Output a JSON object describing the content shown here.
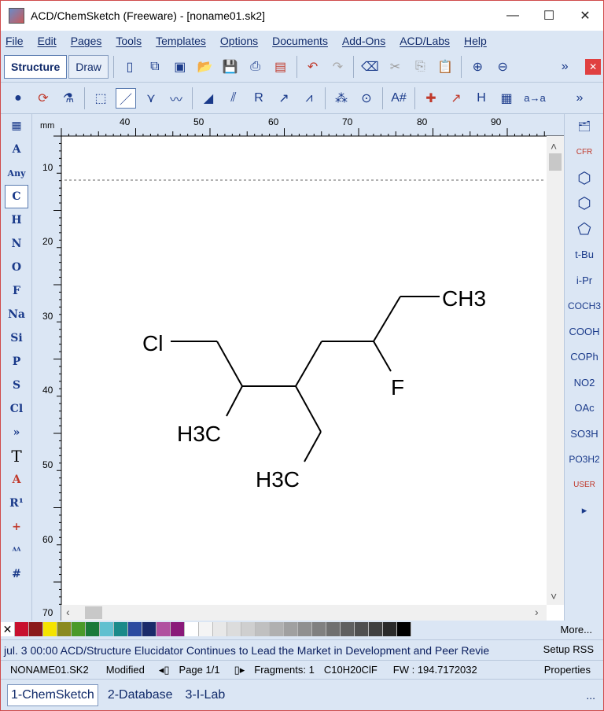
{
  "window": {
    "title": "ACD/ChemSketch (Freeware) - [noname01.sk2]",
    "controls": {
      "minimize": "—",
      "maximize": "☐",
      "close": "✕"
    }
  },
  "menu": [
    "File",
    "Edit",
    "Pages",
    "Tools",
    "Templates",
    "Options",
    "Documents",
    "Add-Ons",
    "ACD/Labs",
    "Help"
  ],
  "modes": {
    "structure": "Structure",
    "draw": "Draw"
  },
  "left_toolbar": [
    "A",
    "Any",
    "C",
    "H",
    "N",
    "O",
    "F",
    "Na",
    "Si",
    "P",
    "S",
    "Cl",
    "»",
    "T",
    "A",
    "R¹",
    "+",
    "ᴬᴬ",
    "#"
  ],
  "right_toolbar": [
    "CFR",
    "⬡",
    "⬡",
    "⬠",
    "t-Bu",
    "i-Pr",
    "COCH3",
    "COOH",
    "COPh",
    "NO2",
    "OAc",
    "SO3H",
    "PO3H2",
    "USER",
    "▸"
  ],
  "ruler": {
    "unit": "mm",
    "top_labels": [
      "40",
      "50",
      "60",
      "70",
      "80",
      "90"
    ],
    "left_labels": [
      "10",
      "20",
      "30",
      "40",
      "50",
      "60",
      "70"
    ]
  },
  "molecule": {
    "labels": {
      "cl": "Cl",
      "ch3": "CH3",
      "f": "F",
      "h3c_1": "H3C",
      "h3c_2": "H3C"
    }
  },
  "palette": {
    "more": "More..."
  },
  "news": {
    "text": "jul. 3 00:00 ACD/Structure Elucidator Continues to Lead the Market in Development and Peer Revie",
    "setup_rss": "Setup RSS"
  },
  "status": {
    "file": "NONAME01.SK2",
    "modified": "Modified",
    "page": "Page 1/1",
    "fragments": "Fragments: 1",
    "formula": "C10H20ClF",
    "fw": "FW : 194.7172032",
    "properties": "Properties"
  },
  "tabs": [
    "1-ChemSketch",
    "2-Database",
    "3-I-Lab"
  ],
  "tabs_more": "..."
}
